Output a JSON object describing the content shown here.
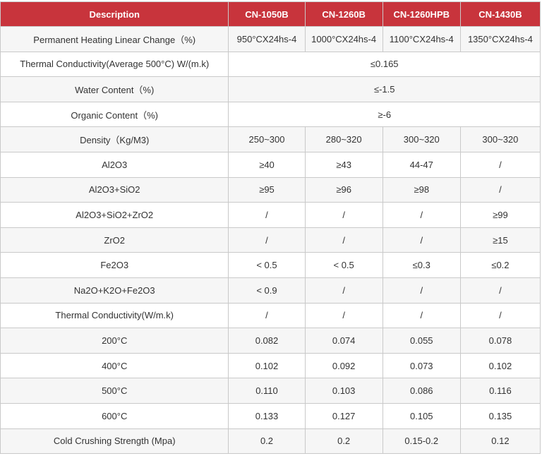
{
  "table": {
    "headers": [
      "Description",
      "CN-1050B",
      "CN-1260B",
      "CN-1260HPB",
      "CN-1430B"
    ],
    "rows": [
      {
        "label": "Permanent Heating Linear Change（%)",
        "values": [
          "950°CX24hs-4",
          "1000°CX24hs-4",
          "1100°CX24hs-4",
          "1350°CX24hs-4"
        ]
      },
      {
        "label": "Thermal Conductivity(Average 500°C) W/(m.k)",
        "span_value": "≤0.165"
      },
      {
        "label": "Water Content（%)",
        "span_value": "≤-1.5"
      },
      {
        "label": "Organic Content（%)",
        "span_value": "≥-6"
      },
      {
        "label": "Density（Kg/M3)",
        "values": [
          "250~300",
          "280~320",
          "300~320",
          "300~320"
        ]
      },
      {
        "label": "Al2O3",
        "values": [
          "≥40",
          "≥43",
          "44-47",
          "/"
        ]
      },
      {
        "label": "Al2O3+SiO2",
        "values": [
          "≥95",
          "≥96",
          "≥98",
          "/"
        ]
      },
      {
        "label": "Al2O3+SiO2+ZrO2",
        "values": [
          "/",
          "/",
          "/",
          "≥99"
        ]
      },
      {
        "label": "ZrO2",
        "values": [
          "/",
          "/",
          "/",
          "≥15"
        ]
      },
      {
        "label": "Fe2O3",
        "values": [
          "< 0.5",
          "< 0.5",
          "≤0.3",
          "≤0.2"
        ]
      },
      {
        "label": "Na2O+K2O+Fe2O3",
        "values": [
          "< 0.9",
          "/",
          "/",
          "/"
        ]
      },
      {
        "label": "Thermal Conductivity(W/m.k)",
        "values": [
          "/",
          "/",
          "/",
          "/"
        ]
      },
      {
        "label": "200°C",
        "values": [
          "0.082",
          "0.074",
          "0.055",
          "0.078"
        ]
      },
      {
        "label": "400°C",
        "values": [
          "0.102",
          "0.092",
          "0.073",
          "0.102"
        ]
      },
      {
        "label": "500°C",
        "values": [
          "0.110",
          "0.103",
          "0.086",
          "0.116"
        ]
      },
      {
        "label": "600°C",
        "values": [
          "0.133",
          "0.127",
          "0.105",
          "0.135"
        ]
      },
      {
        "label": "Cold Crushing Strength (Mpa)",
        "values": [
          "0.2",
          "0.2",
          "0.15-0.2",
          "0.12"
        ]
      }
    ]
  }
}
